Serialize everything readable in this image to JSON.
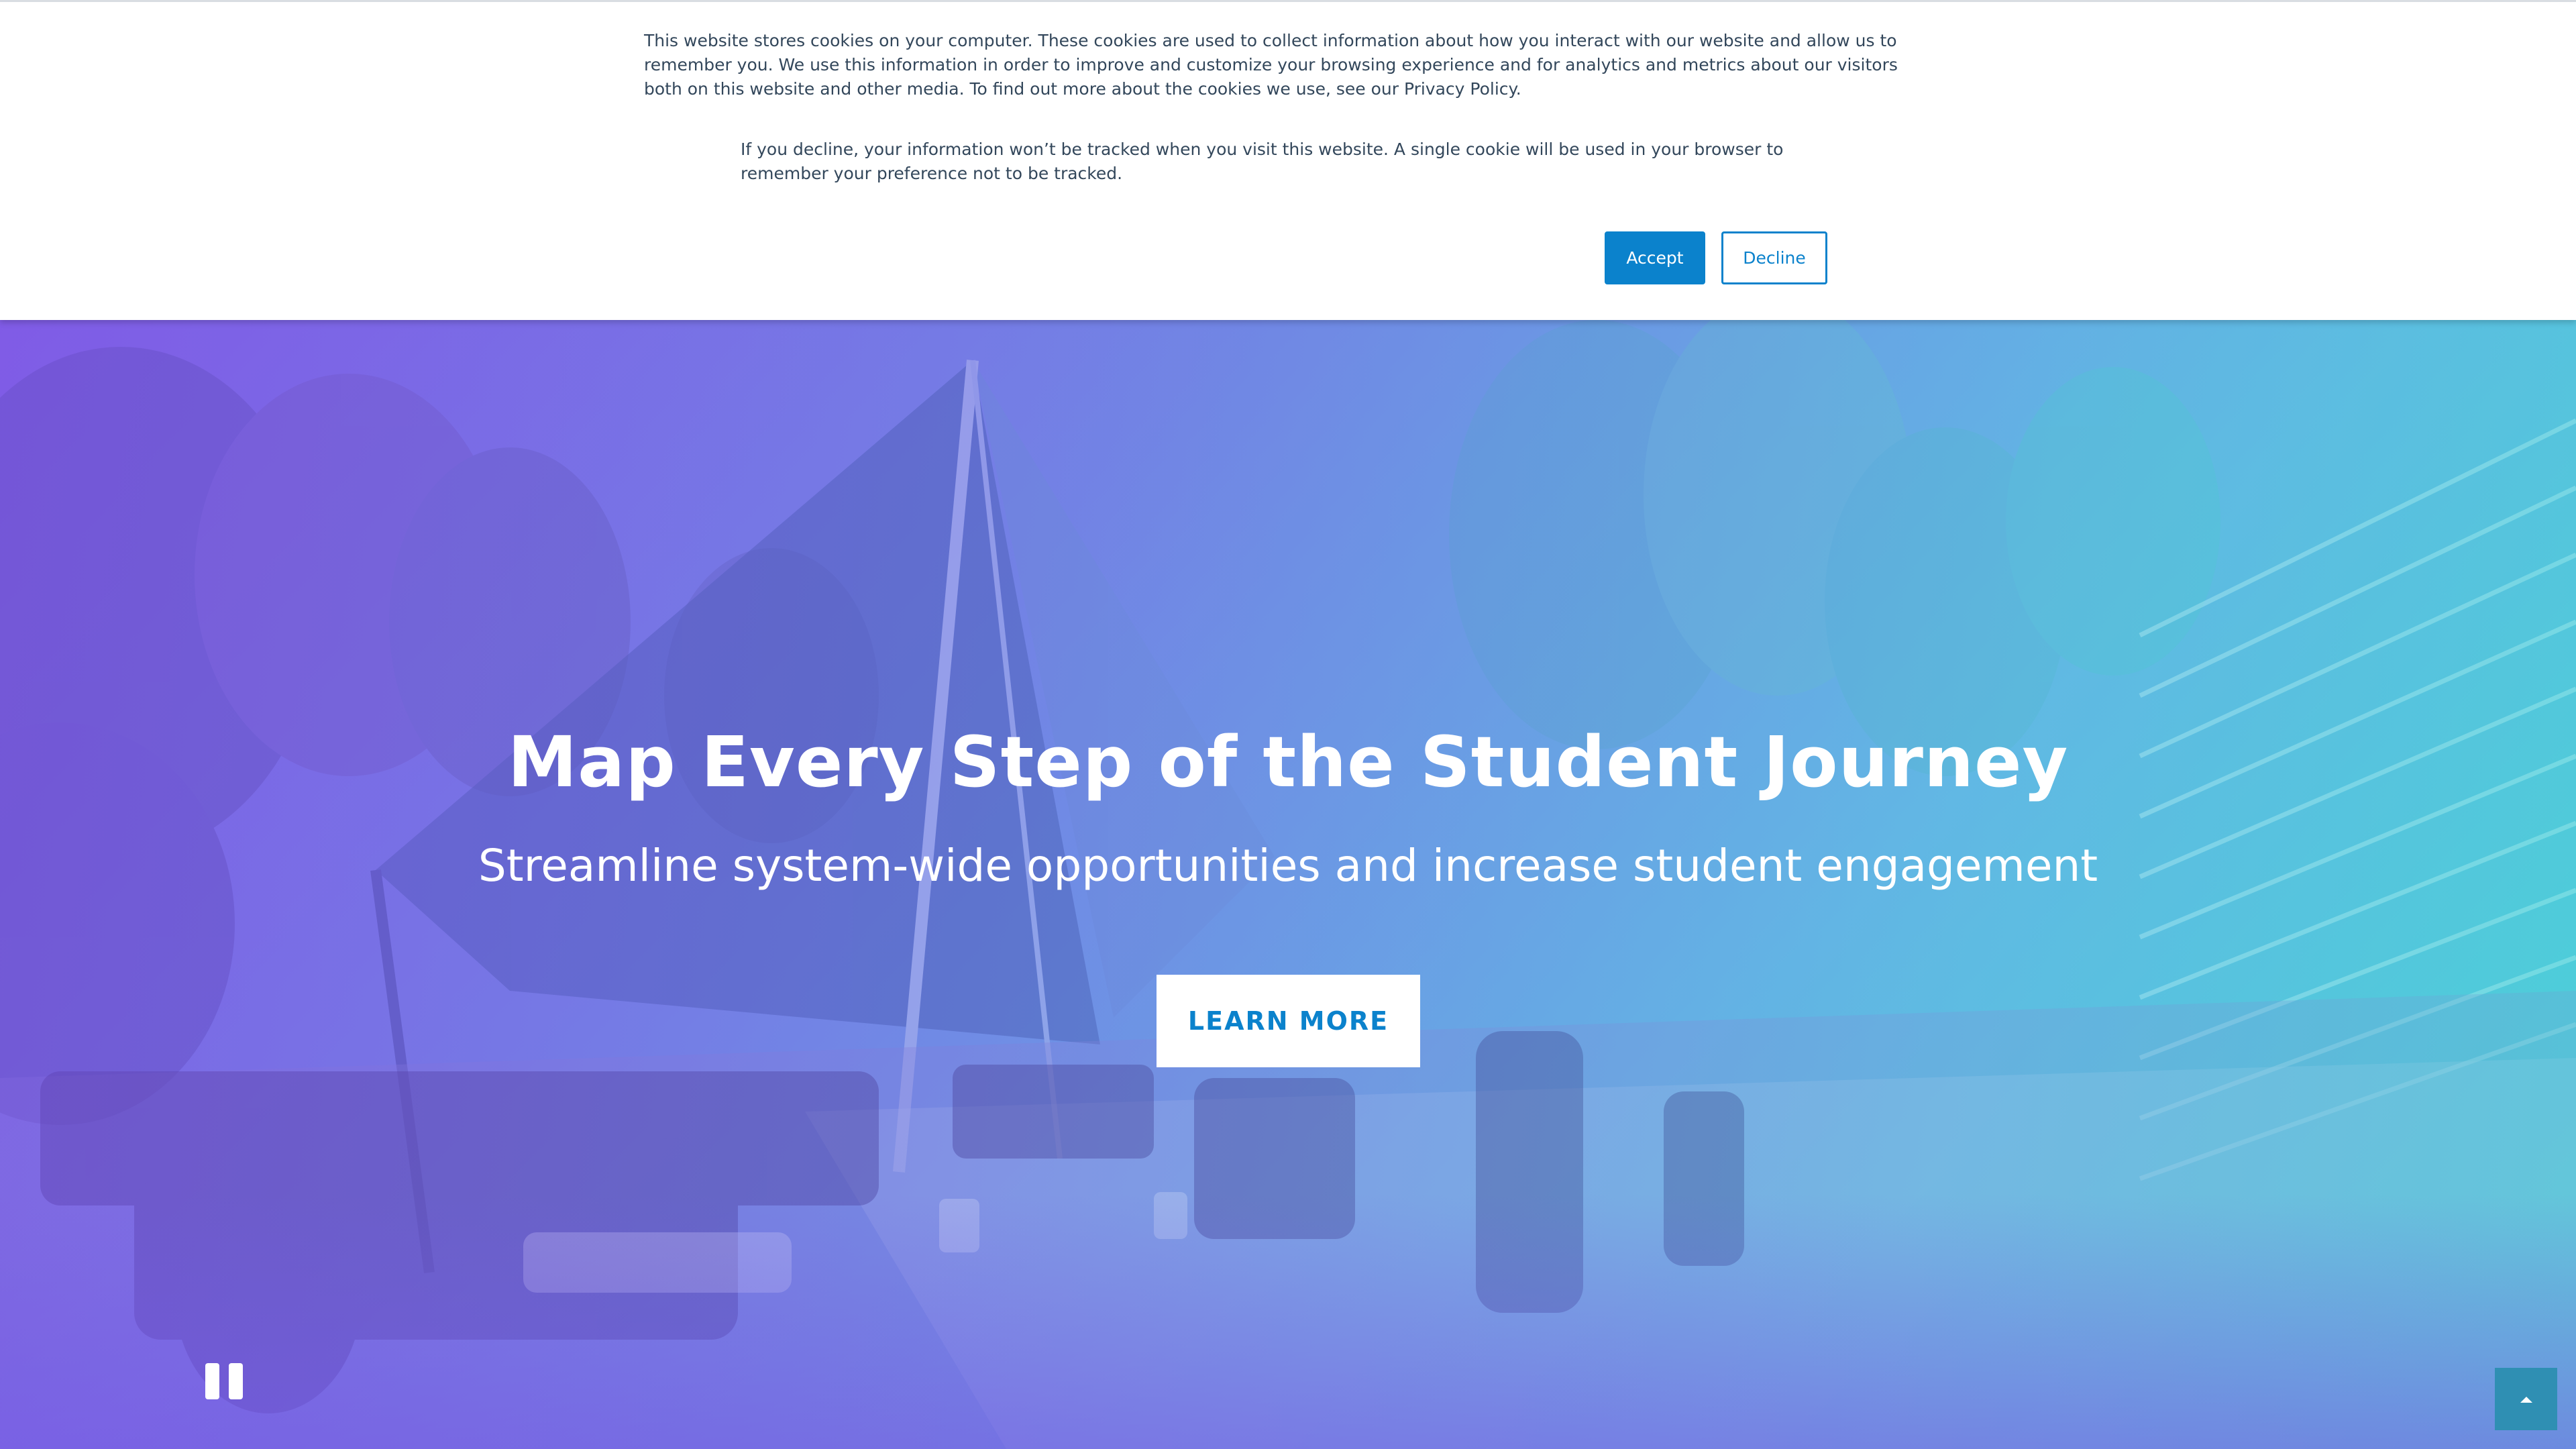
{
  "cookie_banner": {
    "text_primary": "This website stores cookies on your computer. These cookies are used to collect information about how you interact with our website and allow us to remember you. We use this information in order to improve and customize your browsing experience and for analytics and metrics about our visitors both on this website and other media. To find out more about the cookies we use, see our Privacy Policy.",
    "text_decline": "If you decline, your information won’t be tracked when you visit this website. A single cookie will be used in your browser to remember your preference not to be tracked.",
    "accept_label": "Accept",
    "decline_label": "Decline"
  },
  "hero": {
    "title": "Map Every Step of the Student Journey",
    "subtitle": "Streamline system-wide opportunities and increase student engagement",
    "cta_label": "LEARN MORE",
    "pause_icon": "pause-icon",
    "scroll_top_icon": "chevron-up-icon"
  },
  "colors": {
    "accent": "#0b82cc",
    "cookie_text": "#33475b",
    "scroll_top_bg": "#2f8fb3",
    "gradient_start": "#7b55e4",
    "gradient_end": "#3fd8d6"
  }
}
